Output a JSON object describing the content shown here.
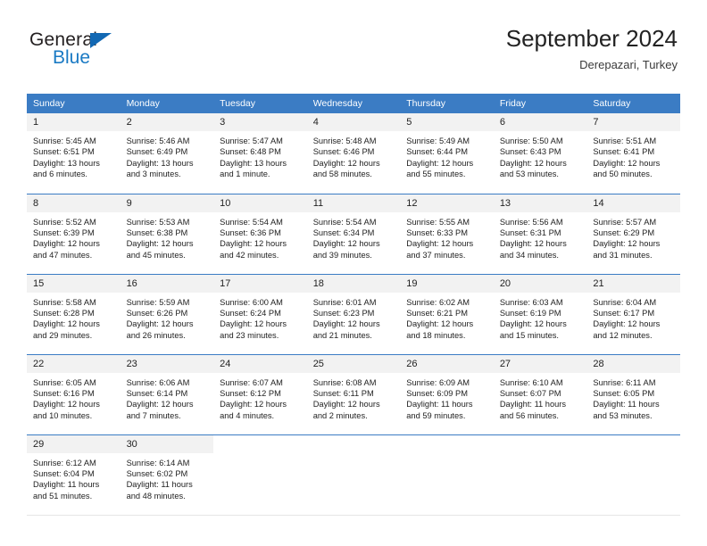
{
  "brand": {
    "logo_text_top": "General",
    "logo_text_bottom": "Blue",
    "accent_color": "#1a7ac4",
    "header_color": "#3b7cc4",
    "triangle_icon": "blue-triangle-icon"
  },
  "header": {
    "title": "September 2024",
    "subtitle": "Derepazari, Turkey"
  },
  "weekday_headers": [
    "Sunday",
    "Monday",
    "Tuesday",
    "Wednesday",
    "Thursday",
    "Friday",
    "Saturday"
  ],
  "weeks": [
    [
      {
        "date": "1",
        "sunrise": "Sunrise: 5:45 AM",
        "sunset": "Sunset: 6:51 PM",
        "daylight_line1": "Daylight: 13 hours",
        "daylight_line2": "and 6 minutes."
      },
      {
        "date": "2",
        "sunrise": "Sunrise: 5:46 AM",
        "sunset": "Sunset: 6:49 PM",
        "daylight_line1": "Daylight: 13 hours",
        "daylight_line2": "and 3 minutes."
      },
      {
        "date": "3",
        "sunrise": "Sunrise: 5:47 AM",
        "sunset": "Sunset: 6:48 PM",
        "daylight_line1": "Daylight: 13 hours",
        "daylight_line2": "and 1 minute."
      },
      {
        "date": "4",
        "sunrise": "Sunrise: 5:48 AM",
        "sunset": "Sunset: 6:46 PM",
        "daylight_line1": "Daylight: 12 hours",
        "daylight_line2": "and 58 minutes."
      },
      {
        "date": "5",
        "sunrise": "Sunrise: 5:49 AM",
        "sunset": "Sunset: 6:44 PM",
        "daylight_line1": "Daylight: 12 hours",
        "daylight_line2": "and 55 minutes."
      },
      {
        "date": "6",
        "sunrise": "Sunrise: 5:50 AM",
        "sunset": "Sunset: 6:43 PM",
        "daylight_line1": "Daylight: 12 hours",
        "daylight_line2": "and 53 minutes."
      },
      {
        "date": "7",
        "sunrise": "Sunrise: 5:51 AM",
        "sunset": "Sunset: 6:41 PM",
        "daylight_line1": "Daylight: 12 hours",
        "daylight_line2": "and 50 minutes."
      }
    ],
    [
      {
        "date": "8",
        "sunrise": "Sunrise: 5:52 AM",
        "sunset": "Sunset: 6:39 PM",
        "daylight_line1": "Daylight: 12 hours",
        "daylight_line2": "and 47 minutes."
      },
      {
        "date": "9",
        "sunrise": "Sunrise: 5:53 AM",
        "sunset": "Sunset: 6:38 PM",
        "daylight_line1": "Daylight: 12 hours",
        "daylight_line2": "and 45 minutes."
      },
      {
        "date": "10",
        "sunrise": "Sunrise: 5:54 AM",
        "sunset": "Sunset: 6:36 PM",
        "daylight_line1": "Daylight: 12 hours",
        "daylight_line2": "and 42 minutes."
      },
      {
        "date": "11",
        "sunrise": "Sunrise: 5:54 AM",
        "sunset": "Sunset: 6:34 PM",
        "daylight_line1": "Daylight: 12 hours",
        "daylight_line2": "and 39 minutes."
      },
      {
        "date": "12",
        "sunrise": "Sunrise: 5:55 AM",
        "sunset": "Sunset: 6:33 PM",
        "daylight_line1": "Daylight: 12 hours",
        "daylight_line2": "and 37 minutes."
      },
      {
        "date": "13",
        "sunrise": "Sunrise: 5:56 AM",
        "sunset": "Sunset: 6:31 PM",
        "daylight_line1": "Daylight: 12 hours",
        "daylight_line2": "and 34 minutes."
      },
      {
        "date": "14",
        "sunrise": "Sunrise: 5:57 AM",
        "sunset": "Sunset: 6:29 PM",
        "daylight_line1": "Daylight: 12 hours",
        "daylight_line2": "and 31 minutes."
      }
    ],
    [
      {
        "date": "15",
        "sunrise": "Sunrise: 5:58 AM",
        "sunset": "Sunset: 6:28 PM",
        "daylight_line1": "Daylight: 12 hours",
        "daylight_line2": "and 29 minutes."
      },
      {
        "date": "16",
        "sunrise": "Sunrise: 5:59 AM",
        "sunset": "Sunset: 6:26 PM",
        "daylight_line1": "Daylight: 12 hours",
        "daylight_line2": "and 26 minutes."
      },
      {
        "date": "17",
        "sunrise": "Sunrise: 6:00 AM",
        "sunset": "Sunset: 6:24 PM",
        "daylight_line1": "Daylight: 12 hours",
        "daylight_line2": "and 23 minutes."
      },
      {
        "date": "18",
        "sunrise": "Sunrise: 6:01 AM",
        "sunset": "Sunset: 6:23 PM",
        "daylight_line1": "Daylight: 12 hours",
        "daylight_line2": "and 21 minutes."
      },
      {
        "date": "19",
        "sunrise": "Sunrise: 6:02 AM",
        "sunset": "Sunset: 6:21 PM",
        "daylight_line1": "Daylight: 12 hours",
        "daylight_line2": "and 18 minutes."
      },
      {
        "date": "20",
        "sunrise": "Sunrise: 6:03 AM",
        "sunset": "Sunset: 6:19 PM",
        "daylight_line1": "Daylight: 12 hours",
        "daylight_line2": "and 15 minutes."
      },
      {
        "date": "21",
        "sunrise": "Sunrise: 6:04 AM",
        "sunset": "Sunset: 6:17 PM",
        "daylight_line1": "Daylight: 12 hours",
        "daylight_line2": "and 12 minutes."
      }
    ],
    [
      {
        "date": "22",
        "sunrise": "Sunrise: 6:05 AM",
        "sunset": "Sunset: 6:16 PM",
        "daylight_line1": "Daylight: 12 hours",
        "daylight_line2": "and 10 minutes."
      },
      {
        "date": "23",
        "sunrise": "Sunrise: 6:06 AM",
        "sunset": "Sunset: 6:14 PM",
        "daylight_line1": "Daylight: 12 hours",
        "daylight_line2": "and 7 minutes."
      },
      {
        "date": "24",
        "sunrise": "Sunrise: 6:07 AM",
        "sunset": "Sunset: 6:12 PM",
        "daylight_line1": "Daylight: 12 hours",
        "daylight_line2": "and 4 minutes."
      },
      {
        "date": "25",
        "sunrise": "Sunrise: 6:08 AM",
        "sunset": "Sunset: 6:11 PM",
        "daylight_line1": "Daylight: 12 hours",
        "daylight_line2": "and 2 minutes."
      },
      {
        "date": "26",
        "sunrise": "Sunrise: 6:09 AM",
        "sunset": "Sunset: 6:09 PM",
        "daylight_line1": "Daylight: 11 hours",
        "daylight_line2": "and 59 minutes."
      },
      {
        "date": "27",
        "sunrise": "Sunrise: 6:10 AM",
        "sunset": "Sunset: 6:07 PM",
        "daylight_line1": "Daylight: 11 hours",
        "daylight_line2": "and 56 minutes."
      },
      {
        "date": "28",
        "sunrise": "Sunrise: 6:11 AM",
        "sunset": "Sunset: 6:05 PM",
        "daylight_line1": "Daylight: 11 hours",
        "daylight_line2": "and 53 minutes."
      }
    ],
    [
      {
        "date": "29",
        "sunrise": "Sunrise: 6:12 AM",
        "sunset": "Sunset: 6:04 PM",
        "daylight_line1": "Daylight: 11 hours",
        "daylight_line2": "and 51 minutes."
      },
      {
        "date": "30",
        "sunrise": "Sunrise: 6:14 AM",
        "sunset": "Sunset: 6:02 PM",
        "daylight_line1": "Daylight: 11 hours",
        "daylight_line2": "and 48 minutes."
      },
      {
        "date": "",
        "sunrise": "",
        "sunset": "",
        "daylight_line1": "",
        "daylight_line2": ""
      },
      {
        "date": "",
        "sunrise": "",
        "sunset": "",
        "daylight_line1": "",
        "daylight_line2": ""
      },
      {
        "date": "",
        "sunrise": "",
        "sunset": "",
        "daylight_line1": "",
        "daylight_line2": ""
      },
      {
        "date": "",
        "sunrise": "",
        "sunset": "",
        "daylight_line1": "",
        "daylight_line2": ""
      },
      {
        "date": "",
        "sunrise": "",
        "sunset": "",
        "daylight_line1": "",
        "daylight_line2": ""
      }
    ]
  ]
}
